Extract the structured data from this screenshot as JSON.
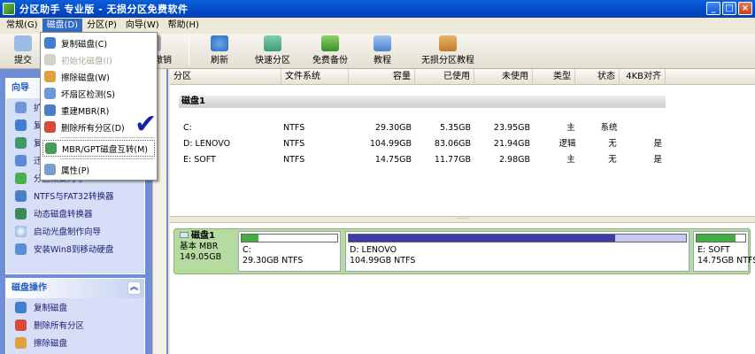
{
  "window": {
    "title": "分区助手 专业版 - 无损分区免费软件",
    "buttons": [
      "_",
      "□",
      "×"
    ]
  },
  "menubar": [
    "常规(G)",
    "磁盘(D)",
    "分区(P)",
    "向导(W)",
    "帮助(H)"
  ],
  "toolbar": {
    "left_labels": [
      "提交",
      "撤销"
    ],
    "items": [
      "刷新",
      "快速分区",
      "免费备份",
      "教程",
      "无损分区教程"
    ]
  },
  "disk_menu": {
    "items": [
      "复制磁盘(C)",
      "初始化磁盘(I)",
      "擦除磁盘(W)",
      "坏扇区检测(S)",
      "重建MBR(R)",
      "删除所有分区(D)",
      "MBR/GPT磁盘互转(M)",
      "属性(P)"
    ]
  },
  "wizard_panel": {
    "title": "向导",
    "partial_items": [
      "扩",
      "复",
      "复",
      "迁"
    ],
    "items": [
      "分区恢复向导",
      "NTFS与FAT32转换器",
      "动态磁盘转换器",
      "启动光盘制作向导",
      "安装Win8到移动硬盘"
    ]
  },
  "disk_ops_panel": {
    "title": "磁盘操作",
    "items": [
      "复制磁盘",
      "删除所有分区",
      "擦除磁盘"
    ]
  },
  "table": {
    "columns": [
      "分区",
      "文件系统",
      "容量",
      "已使用",
      "未使用",
      "类型",
      "状态",
      "4KB对齐"
    ],
    "disk_label": "磁盘1",
    "rows": [
      {
        "part": "C:",
        "fs": "NTFS",
        "cap": "29.30GB",
        "used": "5.35GB",
        "free": "23.95GB",
        "type": "主",
        "status": "系统",
        "align": ""
      },
      {
        "part": "D: LENOVO",
        "fs": "NTFS",
        "cap": "104.99GB",
        "used": "83.06GB",
        "free": "21.94GB",
        "type": "逻辑",
        "status": "无",
        "align": "是"
      },
      {
        "part": "E: SOFT",
        "fs": "NTFS",
        "cap": "14.75GB",
        "used": "11.77GB",
        "free": "2.98GB",
        "type": "主",
        "status": "无",
        "align": "是"
      }
    ]
  },
  "disk_map": {
    "name": "磁盘1",
    "type": "基本 MBR",
    "size": "149.05GB",
    "partitions": [
      {
        "label": "C:",
        "detail": "29.30GB NTFS",
        "used_fraction": 0.18,
        "color": "#3db03d"
      },
      {
        "label": "D: LENOVO",
        "detail": "104.99GB NTFS",
        "used_fraction": 0.79,
        "color": "#3c3ca8"
      },
      {
        "label": "E: SOFT",
        "detail": "14.75GB NTFS",
        "used_fraction": 0.8,
        "color": "#3db03d"
      }
    ]
  },
  "colors": {
    "titlebar": "#0349c7",
    "highlight": "#316ac5",
    "disk_row": "#b6dba0"
  }
}
